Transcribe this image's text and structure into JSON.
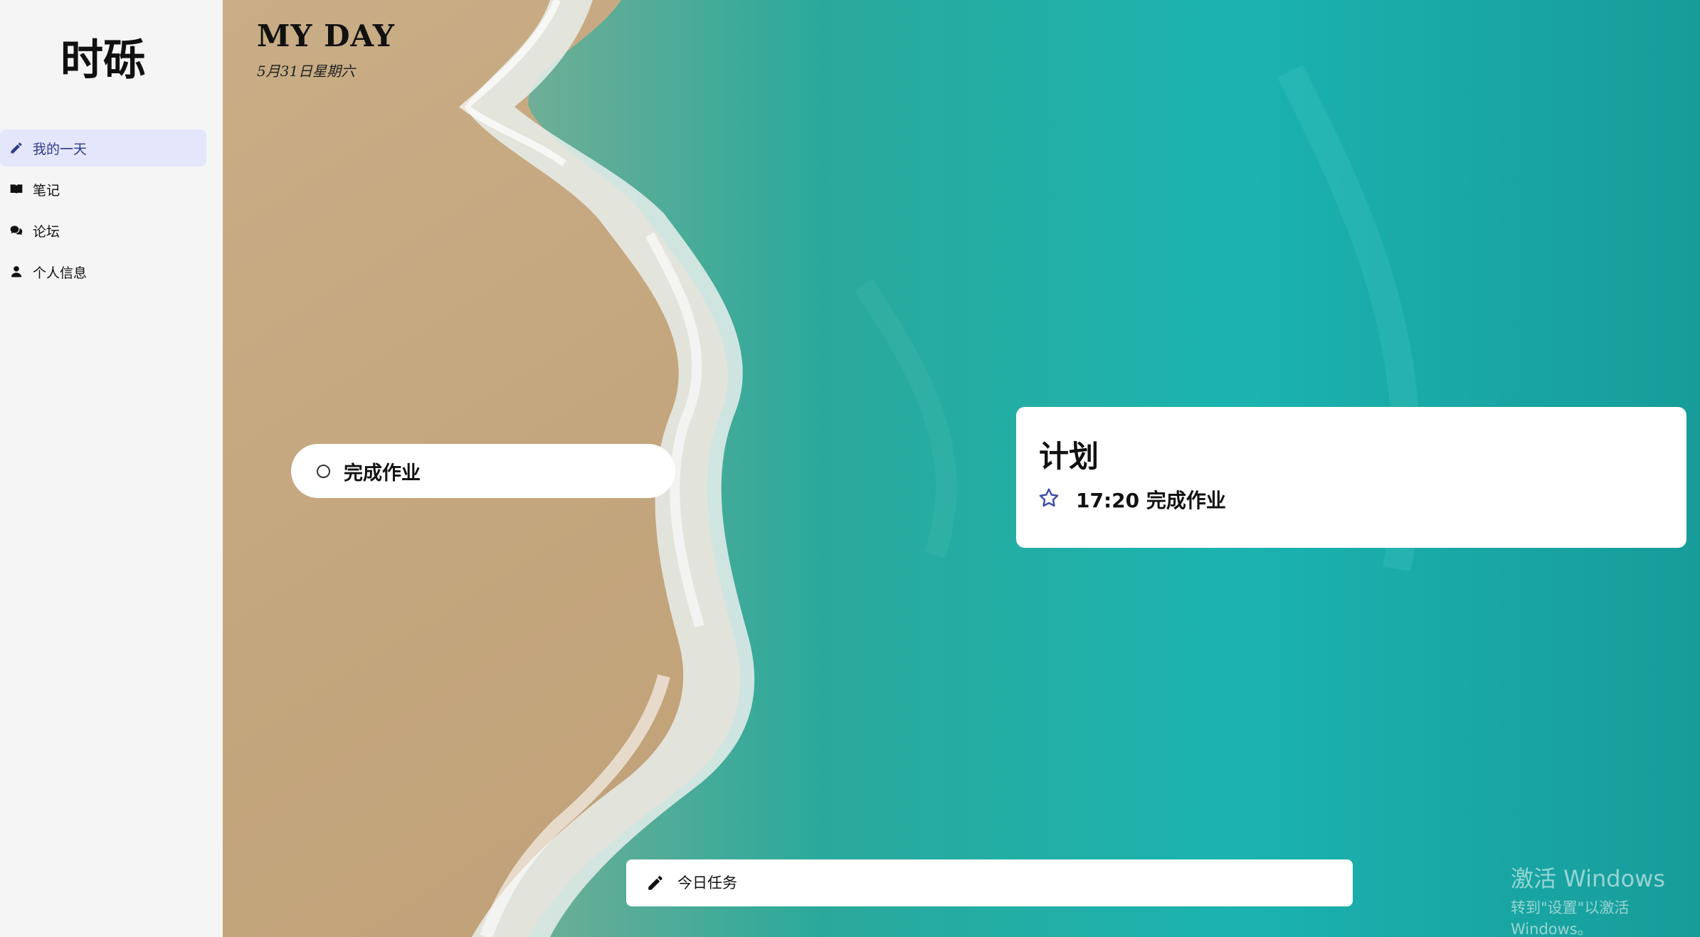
{
  "sidebar": {
    "brand": "时砾",
    "items": [
      {
        "label": "我的一天",
        "icon": "pencil-icon",
        "active": true
      },
      {
        "label": "笔记",
        "icon": "book-icon",
        "active": false
      },
      {
        "label": "论坛",
        "icon": "comments-icon",
        "active": false
      },
      {
        "label": "个人信息",
        "icon": "user-icon",
        "active": false
      }
    ]
  },
  "header": {
    "title": "MY DAY",
    "date": "5月31日星期六"
  },
  "task": {
    "text": "完成作业",
    "icon": "circle-checkbox-icon"
  },
  "plan": {
    "title": "计划",
    "items": [
      {
        "text": "17:20 完成作业",
        "icon": "star-outline-icon"
      }
    ]
  },
  "input": {
    "placeholder": "今日任务",
    "icon": "pencil-icon"
  },
  "watermark": {
    "line1": "激活 Windows",
    "line2": "转到\"设置\"以激活 Windows。"
  },
  "colors": {
    "sidebar_bg": "#f5f5f5",
    "active_bg": "#e4e6fb",
    "accent": "#3b4aa8",
    "sand": "#c7a97f",
    "sea": "#1aa9a2"
  }
}
